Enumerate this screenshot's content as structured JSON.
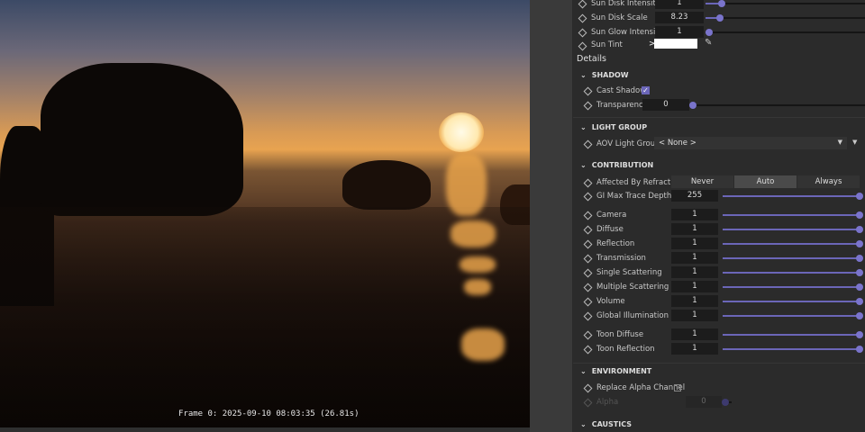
{
  "viewport": {
    "frame_info": "Frame  0:  2025-09-10  08:03:35  (26.81s)"
  },
  "sun": {
    "rows": [
      {
        "label": "Sun Disk Intensity",
        "value": "1",
        "slider": 0.1
      },
      {
        "label": "Sun Disk Scale",
        "value": "8.23",
        "slider": 0.09
      },
      {
        "label": "Sun Glow Intensity",
        "value": "1",
        "slider": 0.02
      }
    ],
    "tint": {
      "label": "Sun Tint",
      "color": "#ffffff"
    }
  },
  "details_title": "Details",
  "shadow": {
    "title": "SHADOW",
    "cast_shadow": {
      "label": "Cast Shadow",
      "checked": true
    },
    "transparency": {
      "label": "Transparency",
      "value": "0",
      "slider": 0
    }
  },
  "light_group": {
    "title": "LIGHT GROUP",
    "aov": {
      "label": "AOV Light Group",
      "value": "< None >"
    }
  },
  "contribution": {
    "title": "CONTRIBUTION",
    "refraction": {
      "label": "Affected By Refraction",
      "options": [
        "Never",
        "Auto",
        "Always"
      ],
      "selected": "Auto"
    },
    "gi_depth": {
      "label": "GI Max Trace Depth",
      "value": "255",
      "slider": 1
    },
    "items": [
      {
        "label": "Camera",
        "value": "1",
        "slider": 1
      },
      {
        "label": "Diffuse",
        "value": "1",
        "slider": 1
      },
      {
        "label": "Reflection",
        "value": "1",
        "slider": 1
      },
      {
        "label": "Transmission",
        "value": "1",
        "slider": 1
      },
      {
        "label": "Single Scattering",
        "value": "1",
        "slider": 1
      },
      {
        "label": "Multiple Scattering",
        "value": "1",
        "slider": 1
      },
      {
        "label": "Volume",
        "value": "1",
        "slider": 1
      },
      {
        "label": "Global Illumination",
        "value": "1",
        "slider": 1
      },
      {
        "label": "Toon Diffuse",
        "value": "1",
        "slider": 1
      },
      {
        "label": "Toon Reflection",
        "value": "1",
        "slider": 1
      }
    ]
  },
  "environment": {
    "title": "ENVIRONMENT",
    "replace_alpha": {
      "label": "Replace Alpha Channel",
      "checked": false
    },
    "alpha": {
      "label": "Alpha",
      "value": "0"
    }
  },
  "caustics": {
    "title": "CAUSTICS"
  },
  "colors": {
    "accent": "#6b66b8",
    "panel_bg": "#2b2b2b"
  }
}
